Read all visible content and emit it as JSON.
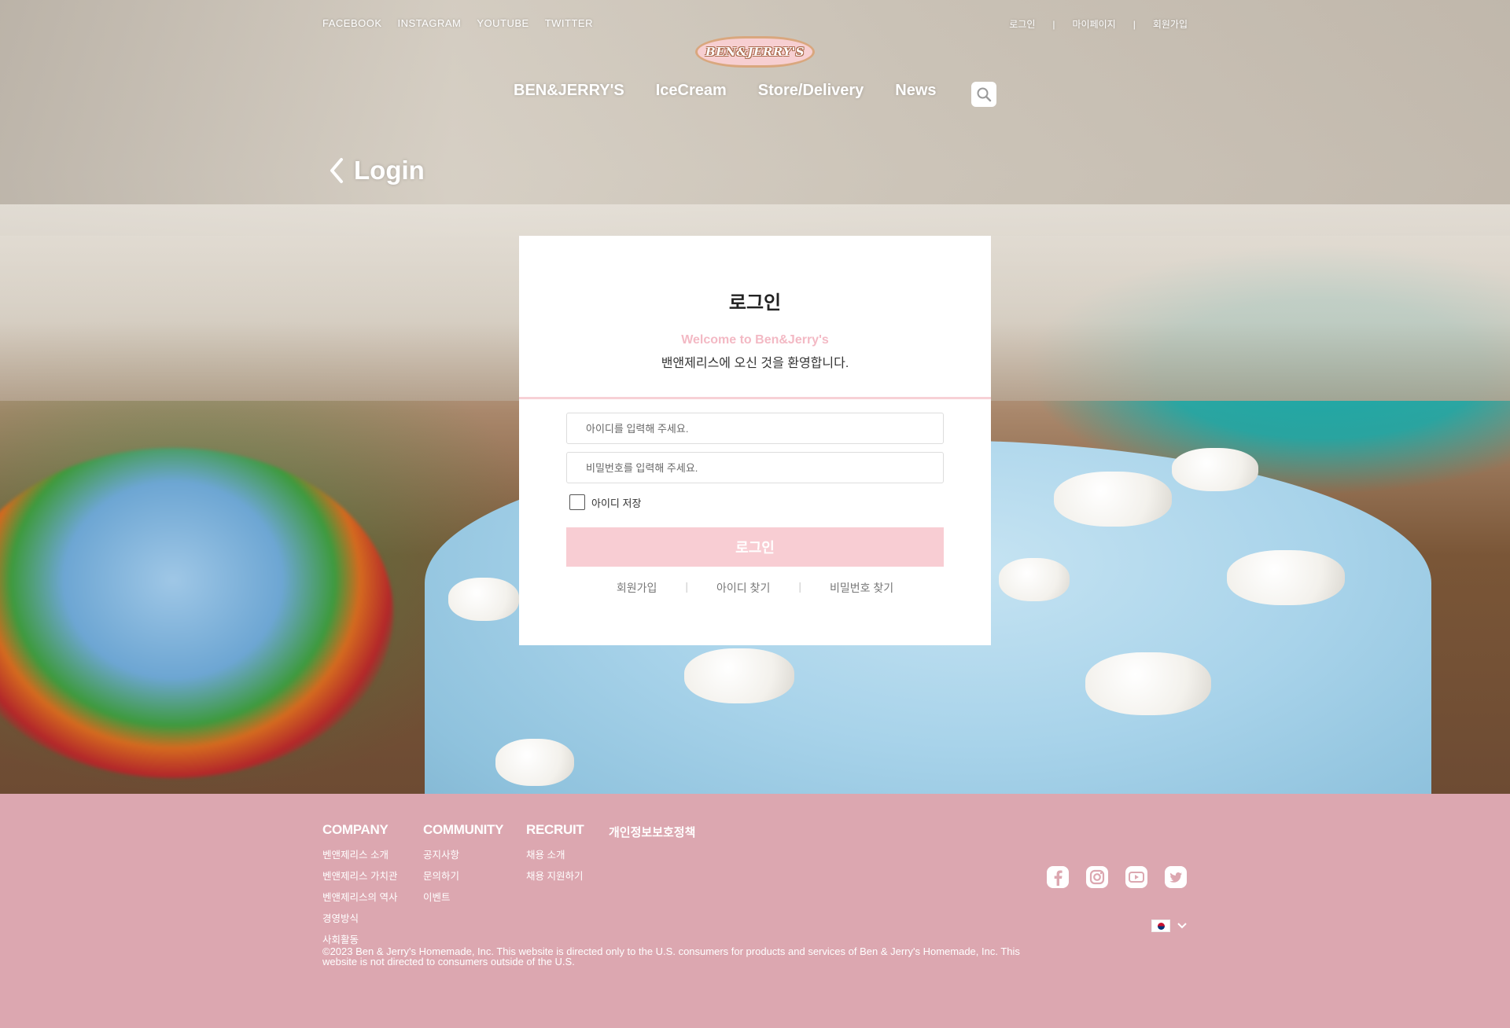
{
  "header": {
    "social_links": [
      "FACEBOOK",
      "INSTAGRAM",
      "YOUTUBE",
      "TWITTER"
    ],
    "util_links": {
      "login": "로그인",
      "mypage": "마이페이지",
      "signup": "회원가입",
      "separator": "|"
    },
    "logo_text": "BEN&JERRY'S",
    "nav": [
      "BEN&JERRY'S",
      "IceCream",
      "Store/Delivery",
      "News"
    ],
    "search_icon": "search-icon"
  },
  "page": {
    "back_icon": "chevron-left-icon",
    "title": "Login"
  },
  "login_card": {
    "title": "로그인",
    "welcome": "Welcome to Ben&Jerry's",
    "subtitle": "밴앤제리스에 오신 것을 환영합니다.",
    "id_placeholder": "아이디를 입력해 주세요.",
    "pw_placeholder": "비밀번호를 입력해 주세요.",
    "remember_label": "아이디 저장",
    "remember_checked": false,
    "submit_label": "로그인",
    "links": {
      "signup": "회원가입",
      "find_id": "아이디 찾기",
      "find_pw": "비밀번호 찾기",
      "separator": "|"
    },
    "accent_color": "#f8cdd3"
  },
  "footer": {
    "company": {
      "heading": "COMPANY",
      "items": [
        "벤앤제리스 소개",
        "벤앤제리스 가치관",
        "벤앤제리스의 역사",
        "경영방식",
        "사회활동"
      ]
    },
    "community": {
      "heading": "COMMUNITY",
      "items": [
        "공지사항",
        "문의하기",
        "이벤트"
      ]
    },
    "recruit": {
      "heading": "RECRUIT",
      "items": [
        "채용 소개",
        "채용 지원하기"
      ]
    },
    "privacy": "개인정보보호정책",
    "copyright": "©2023 Ben & Jerry's Homemade, Inc. This website is directed only to the U.S. consumers for products and services of Ben & Jerry's Homemade, Inc. This website is not directed to consumers outside of the U.S.",
    "sns_icons": [
      "facebook-icon",
      "instagram-icon",
      "youtube-icon",
      "twitter-icon"
    ],
    "language_icon": "korea-flag-icon",
    "background_color": "#dca7b0"
  }
}
